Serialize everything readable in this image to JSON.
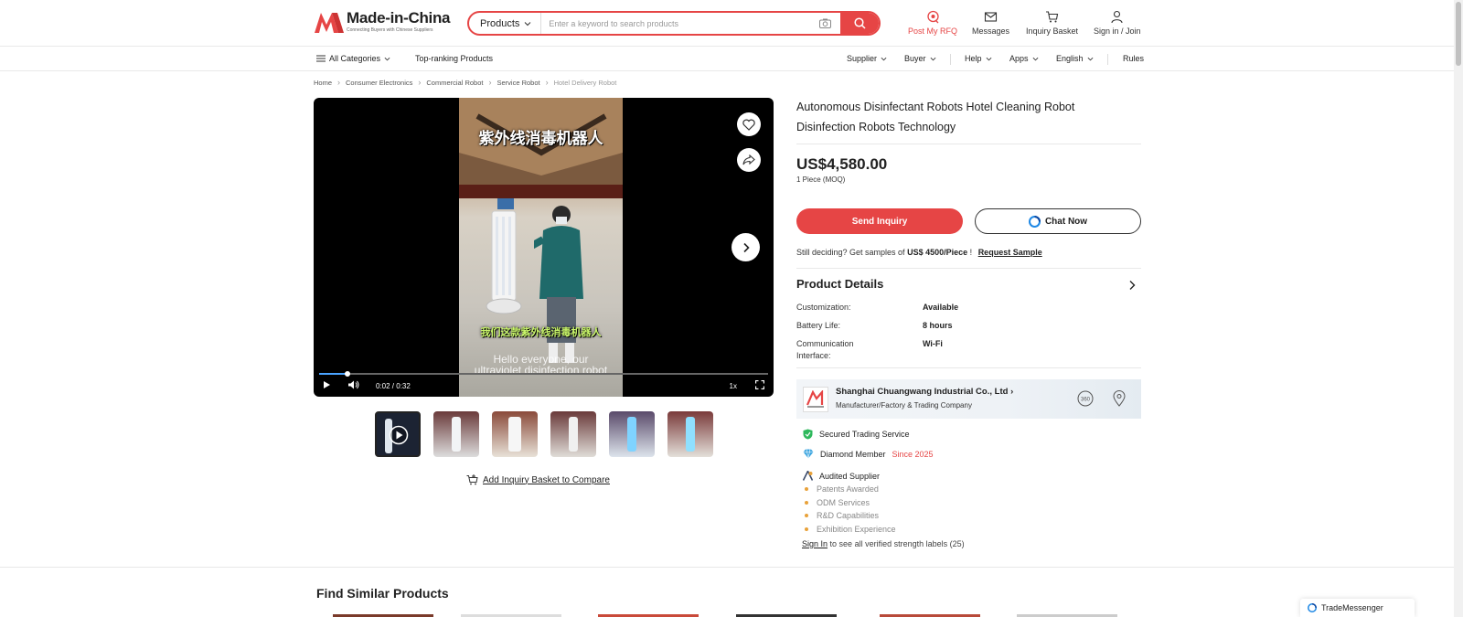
{
  "brand": {
    "name": "Made-in-China",
    "tagline": "Connecting Buyers with Chinese Suppliers",
    "accent_color": "#e64545"
  },
  "search": {
    "category": "Products",
    "placeholder": "Enter a keyword to search products"
  },
  "header_nav": [
    {
      "label": "Post My RFQ",
      "icon": "rfq-icon"
    },
    {
      "label": "Messages",
      "icon": "mail-icon"
    },
    {
      "label": "Inquiry Basket",
      "icon": "cart-icon"
    },
    {
      "label": "Sign in / Join",
      "icon": "user-icon"
    }
  ],
  "subnav": {
    "all_categories": "All Categories",
    "top_ranking": "Top-ranking Products",
    "supplier": "Supplier",
    "buyer": "Buyer",
    "help": "Help",
    "apps": "Apps",
    "language": "English",
    "rules": "Rules"
  },
  "breadcrumb": [
    "Home",
    "Consumer Electronics",
    "Commercial Robot",
    "Service Robot",
    "Hotel Delivery Robot"
  ],
  "video": {
    "subtitle_top": "紫外线消毒机器人",
    "subtitle_bottom": "我们这款紫外线消毒机器人",
    "caption_line1": "Hello everyone, our",
    "caption_line2": "ultraviolet disinfection robot",
    "time": "0:02 / 0:32",
    "speed": "1x",
    "progress": 0.063
  },
  "thumbnails_count": 6,
  "add_basket": "Add Inquiry Basket to Compare",
  "product": {
    "title": "Autonomous Disinfectant Robots Hotel Cleaning Robot Disinfection Robots Technology",
    "price": "US$4,580.00",
    "moq": "1 Piece (MOQ)",
    "send_inquiry": "Send Inquiry",
    "chat_now": "Chat Now",
    "sample_prefix": "Still deciding? Get samples of",
    "sample_price": "US$ 4500/Piece",
    "sample_suffix": "!",
    "request_sample": "Request Sample"
  },
  "details": {
    "title": "Product Details",
    "attrs": [
      {
        "label": "Customization:",
        "value": "Available"
      },
      {
        "label": "Battery Life:",
        "value": "8 hours"
      },
      {
        "label": "Communication Interface:",
        "value": "Wi-Fi"
      }
    ]
  },
  "supplier": {
    "name": "Shanghai Chuangwang Industrial Co., Ltd",
    "type": "Manufacturer/Factory & Trading Company"
  },
  "features": {
    "secured": "Secured Trading Service",
    "diamond": "Diamond Member",
    "diamond_since": "Since 2025",
    "audited": "Audited Supplier",
    "audited_items": [
      "Patents Awarded",
      "ODM Services",
      "R&D Capabilities",
      "Exhibition Experience"
    ],
    "sign_in": "Sign In",
    "sign_in_note": "to see all verified strength labels (25)"
  },
  "similar_title": "Find Similar Products",
  "trade_messenger": "TradeMessenger"
}
